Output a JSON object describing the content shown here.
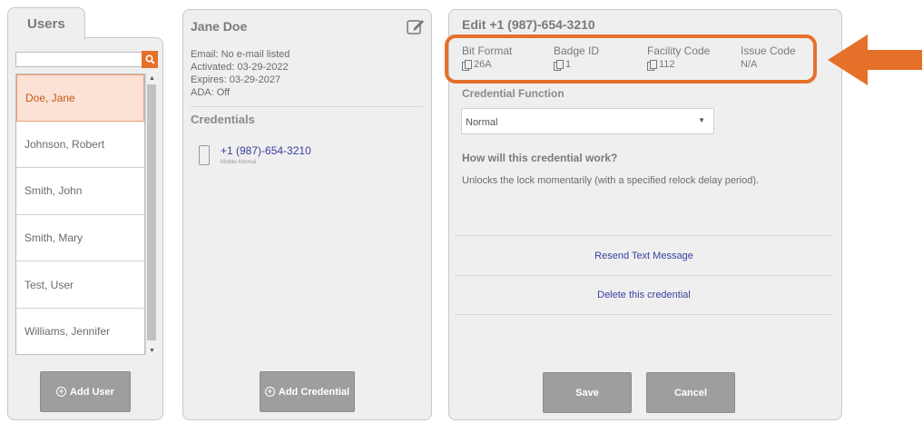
{
  "users_panel": {
    "tab_label": "Users",
    "search": {
      "value": "",
      "placeholder": ""
    },
    "users": [
      {
        "name": "Doe, Jane",
        "selected": true
      },
      {
        "name": "Johnson, Robert",
        "selected": false
      },
      {
        "name": "Smith, John",
        "selected": false
      },
      {
        "name": "Smith, Mary",
        "selected": false
      },
      {
        "name": "Test, User",
        "selected": false
      },
      {
        "name": "Williams, Jennifer",
        "selected": false
      }
    ],
    "add_user_label": "Add User"
  },
  "details_panel": {
    "name": "Jane Doe",
    "email": "Email: No e-mail listed",
    "activated": "Activated: 03-29-2022",
    "expires": "Expires: 03-29-2027",
    "ada": "ADA: Off",
    "credentials_heading": "Credentials",
    "credential": {
      "number": "+1 (987)-654-3210",
      "type": "Mobile-Normal"
    },
    "add_credential_label": "Add Credential"
  },
  "edit_panel": {
    "title": "Edit +1 (987)-654-3210",
    "info": [
      {
        "label": "Bit Format",
        "value": "26A",
        "copy": true
      },
      {
        "label": "Badge ID",
        "value": "1",
        "copy": true
      },
      {
        "label": "Facility Code",
        "value": "112",
        "copy": true
      },
      {
        "label": "Issue Code",
        "value": "N/A",
        "copy": false
      }
    ],
    "function_label": "Credential Function",
    "function_value": "Normal",
    "how_heading": "How will this credential work?",
    "how_text": "Unlocks the lock momentarily (with a specified relock delay period).",
    "resend_label": "Resend Text Message",
    "delete_label": "Delete this credential",
    "save_label": "Save",
    "cancel_label": "Cancel"
  },
  "colors": {
    "accent": "#e5702a",
    "link": "#3a3fa0",
    "selected_bg": "#fbe2d4",
    "button_gray": "#9e9e9e"
  },
  "icons": [
    "search-icon",
    "edit-icon",
    "phone-icon",
    "copy-icon",
    "plus-circle-icon",
    "arrow-left-icon"
  ]
}
